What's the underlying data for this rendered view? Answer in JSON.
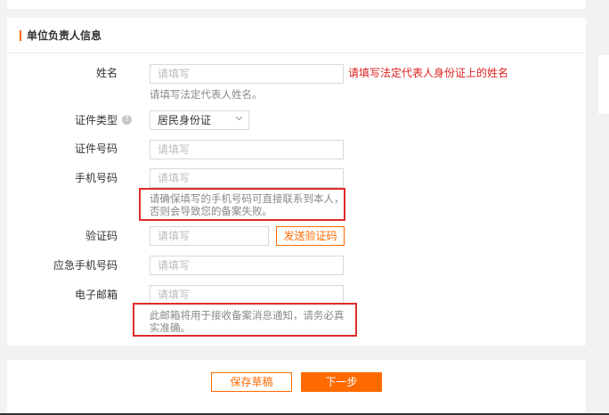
{
  "section": {
    "title": "单位负责人信息"
  },
  "form": {
    "name": {
      "label": "姓名",
      "placeholder": "请填写",
      "error": "请填写法定代表人身份证上的姓名",
      "hint": "请填写法定代表人姓名。"
    },
    "id_type": {
      "label": "证件类型",
      "help_icon": "?",
      "value": "居民身份证"
    },
    "id_number": {
      "label": "证件号码",
      "placeholder": "请填写"
    },
    "phone": {
      "label": "手机号码",
      "placeholder": "请填写",
      "hint_line1": "请确保填写的手机号码可直接联系到本人，",
      "hint_line2": "否则会导致您的备案失败。"
    },
    "verify": {
      "label": "验证码",
      "placeholder": "请填写",
      "button": "发送验证码"
    },
    "emergency_phone": {
      "label": "应急手机号码",
      "placeholder": "请填写"
    },
    "email": {
      "label": "电子邮箱",
      "placeholder": "请填写",
      "hint_line1": "此邮箱将用于接收备案消息通知，请务必真",
      "hint_line2": "实准确。"
    }
  },
  "footer": {
    "save_draft": "保存草稿",
    "next": "下一步"
  },
  "colors": {
    "accent": "#ff6a00",
    "error": "#e02020",
    "highlight_box": "#e02b2b"
  },
  "icons": {
    "select_arrow": "chevron-down-icon",
    "help": "question-circle-icon"
  }
}
